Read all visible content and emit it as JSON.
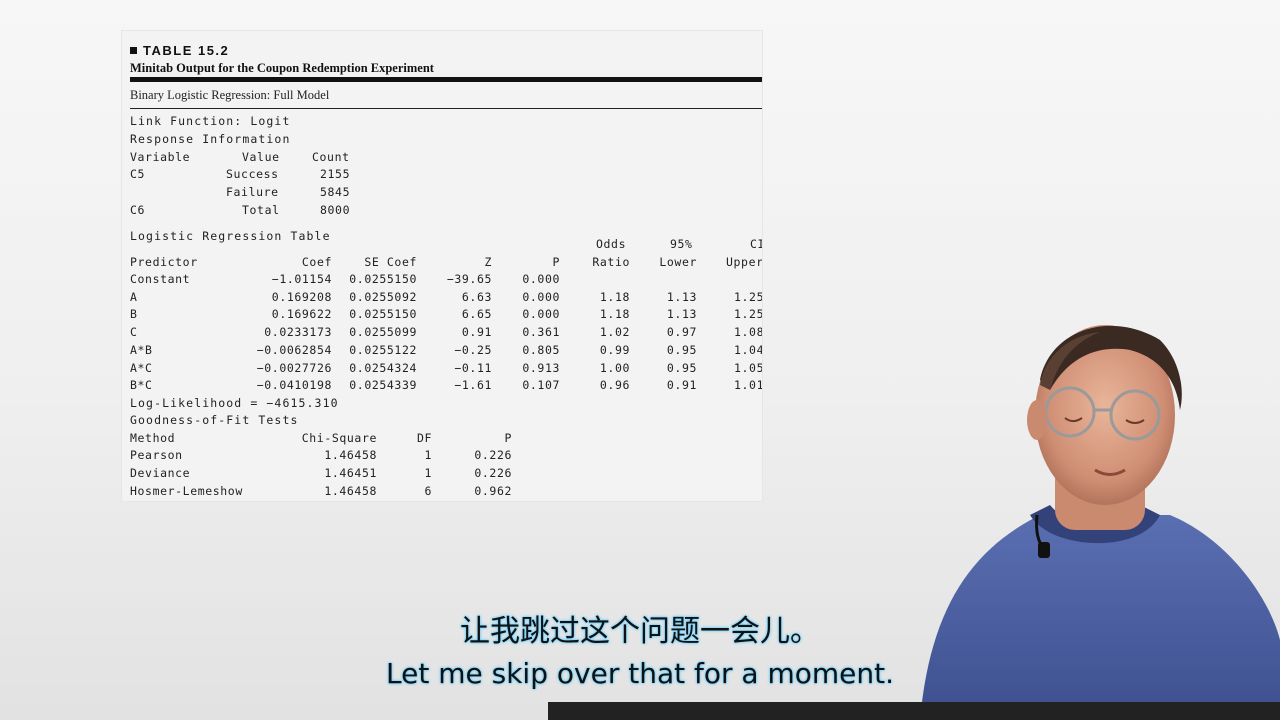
{
  "table": {
    "number": "TABLE 15.2",
    "title": "Minitab Output for the Coupon Redemption Experiment",
    "subhead": "Binary Logistic Regression: Full Model",
    "link_function": "Link Function: Logit",
    "response_info": "Response Information",
    "resp_header": [
      "Variable",
      "Value",
      "Count"
    ],
    "resp_rows": [
      [
        "C5",
        "Success",
        "2155"
      ],
      [
        "",
        "Failure",
        "5845"
      ],
      [
        "C6",
        "Total",
        "8000"
      ]
    ],
    "lr_title": "Logistic Regression Table",
    "lr_header1": [
      "Odds",
      "95%",
      "CI"
    ],
    "lr_header2": [
      "Predictor",
      "Coef",
      "SE Coef",
      "Z",
      "P",
      "Ratio",
      "Lower",
      "Upper"
    ],
    "lr_rows": [
      [
        "Constant",
        "−1.01154",
        "0.0255150",
        "−39.65",
        "0.000",
        "",
        "",
        ""
      ],
      [
        "A",
        "0.169208",
        "0.0255092",
        "6.63",
        "0.000",
        "1.18",
        "1.13",
        "1.25"
      ],
      [
        "B",
        "0.169622",
        "0.0255150",
        "6.65",
        "0.000",
        "1.18",
        "1.13",
        "1.25"
      ],
      [
        "C",
        "0.0233173",
        "0.0255099",
        "0.91",
        "0.361",
        "1.02",
        "0.97",
        "1.08"
      ],
      [
        "A*B",
        "−0.0062854",
        "0.0255122",
        "−0.25",
        "0.805",
        "0.99",
        "0.95",
        "1.04"
      ],
      [
        "A*C",
        "−0.0027726",
        "0.0254324",
        "−0.11",
        "0.913",
        "1.00",
        "0.95",
        "1.05"
      ],
      [
        "B*C",
        "−0.0410198",
        "0.0254339",
        "−1.61",
        "0.107",
        "0.96",
        "0.91",
        "1.01"
      ]
    ],
    "log_likelihood": "Log-Likelihood = −4615.310",
    "gof_title": "Goodness-of-Fit Tests",
    "gof_header": [
      "Method",
      "Chi-Square",
      "DF",
      "P"
    ],
    "gof_rows": [
      [
        "Pearson",
        "1.46458",
        "1",
        "0.226"
      ],
      [
        "Deviance",
        "1.46451",
        "1",
        "0.226"
      ],
      [
        "Hosmer-Lemeshow",
        "1.46458",
        "6",
        "0.962"
      ]
    ]
  },
  "subtitles": {
    "chinese": "让我跳过这个问题一会儿。",
    "english": "Let me skip over that for a moment."
  }
}
